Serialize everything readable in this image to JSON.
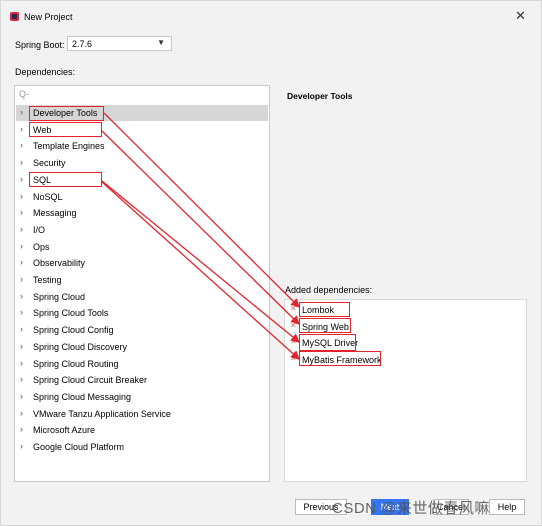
{
  "window": {
    "title": "New Project"
  },
  "spring_boot": {
    "label": "Spring Boot:",
    "value": "2.7.6"
  },
  "dependencies_label": "Dependencies:",
  "search": {
    "glyph": "Q-"
  },
  "categories": [
    "Developer Tools",
    "Web",
    "Template Engines",
    "Security",
    "SQL",
    "NoSQL",
    "Messaging",
    "I/O",
    "Ops",
    "Observability",
    "Testing",
    "Spring Cloud",
    "Spring Cloud Tools",
    "Spring Cloud Config",
    "Spring Cloud Discovery",
    "Spring Cloud Routing",
    "Spring Cloud Circuit Breaker",
    "Spring Cloud Messaging",
    "VMware Tanzu Application Service",
    "Microsoft Azure",
    "Google Cloud Platform"
  ],
  "selected_category": "Developer Tools",
  "detail": {
    "title": "Developer Tools"
  },
  "added": {
    "label": "Added dependencies:",
    "items": [
      "Lombok",
      "Spring Web",
      "MySQL Driver",
      "MyBatis Framework"
    ]
  },
  "buttons": {
    "previous": "Previous",
    "next": "Next",
    "cancel": "Cancel",
    "help": "Help"
  },
  "watermark": "CSDN @来世做春风嘛",
  "colors": {
    "highlight": "#e0252e",
    "selection": "#d6d6d6",
    "primary_button": "#3574f0"
  }
}
